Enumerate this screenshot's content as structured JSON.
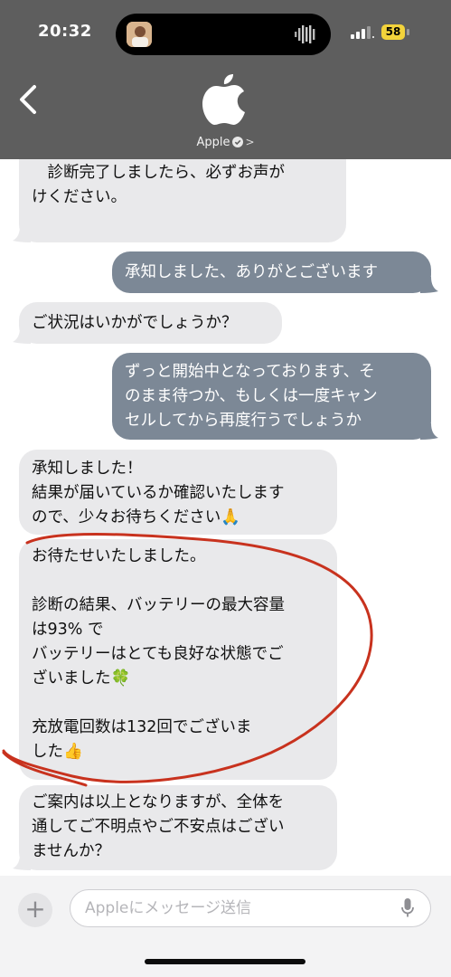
{
  "status_bar": {
    "time": "20:32",
    "battery": "58"
  },
  "header": {
    "contact_name": "Apple"
  },
  "messages": [
    {
      "side": "in",
      "lines": [
        "　診断完了しましたら、必ずお声が",
        "けください。"
      ]
    },
    {
      "side": "out",
      "lines": [
        "承知しました、ありがとございます"
      ]
    },
    {
      "side": "in",
      "lines": [
        "ご状況はいかがでしょうか？"
      ]
    },
    {
      "side": "out",
      "lines": [
        "ずっと開始中となっております、そ",
        "のまま待つか、もしくは一度キャン",
        "セルしてから再度行うでしょうか"
      ]
    },
    {
      "side": "in",
      "lines": [
        "承知しました！",
        "結果が届いているか確認いたします",
        "ので、少々お待ちください🙏"
      ]
    },
    {
      "side": "in",
      "lines": [
        "お待たせいたしました。",
        "",
        "診断の結果、バッテリーの最大容量",
        "は93% で",
        "バッテリーはとても良好な状態でご",
        "ざいました🍀",
        "",
        "充放電回数は132回でございま",
        "した👍"
      ]
    },
    {
      "side": "in",
      "lines": [
        "ご案内は以上となりますが、全体を",
        "通してご不明点やご不安点はござい",
        "ませんか？"
      ]
    }
  ],
  "input": {
    "placeholder": "Appleにメッセージ送信"
  },
  "colors": {
    "header_bg": "#5e5e5e",
    "incoming_bubble": "#e9e9eb",
    "outgoing_bubble": "#7c8896",
    "annotation_red": "#c8321e"
  },
  "icons": [
    "back-chevron-icon",
    "apple-logo-icon",
    "verified-badge-icon",
    "plus-icon",
    "microphone-icon"
  ]
}
